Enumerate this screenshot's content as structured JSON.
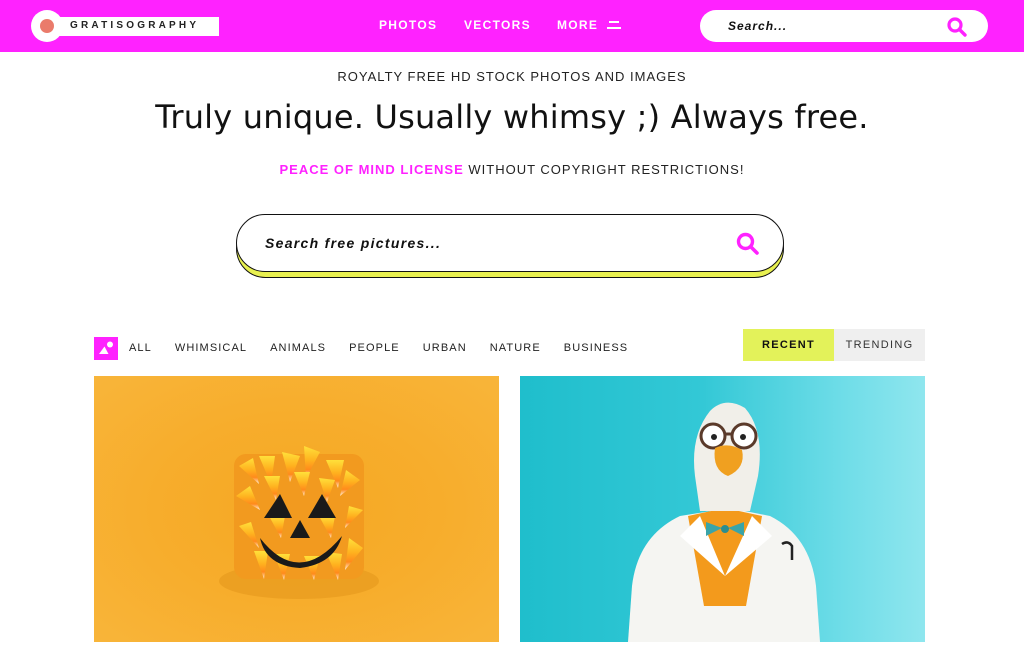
{
  "header": {
    "logo_text": "GRATISOGRAPHY",
    "nav": [
      {
        "label": "PHOTOS"
      },
      {
        "label": "VECTORS"
      },
      {
        "label": "MORE"
      }
    ],
    "search_placeholder": "Search...",
    "brand_color": "#ff22ff"
  },
  "hero": {
    "subtitle": "ROYALTY FREE HD STOCK PHOTOS AND IMAGES",
    "headline": "Truly unique. Usually whimsy ;) Always free.",
    "license_link": "PEACE OF MIND LICENSE",
    "license_rest": " WITHOUT COPYRIGHT RESTRICTIONS!",
    "search_placeholder": "Search free pictures..."
  },
  "filters": {
    "categories": [
      "ALL",
      "WHIMSICAL",
      "ANIMALS",
      "PEOPLE",
      "URBAN",
      "NATURE",
      "BUSINESS"
    ],
    "sort": [
      {
        "label": "RECENT",
        "active": true
      },
      {
        "label": "TRENDING",
        "active": false
      }
    ],
    "accent_color": "#e3f25a"
  },
  "photos": [
    {
      "description": "Candy corn jack-o-lantern face on orange background"
    },
    {
      "description": "Duck wearing glasses and lab coat with bow tie on teal background"
    }
  ]
}
